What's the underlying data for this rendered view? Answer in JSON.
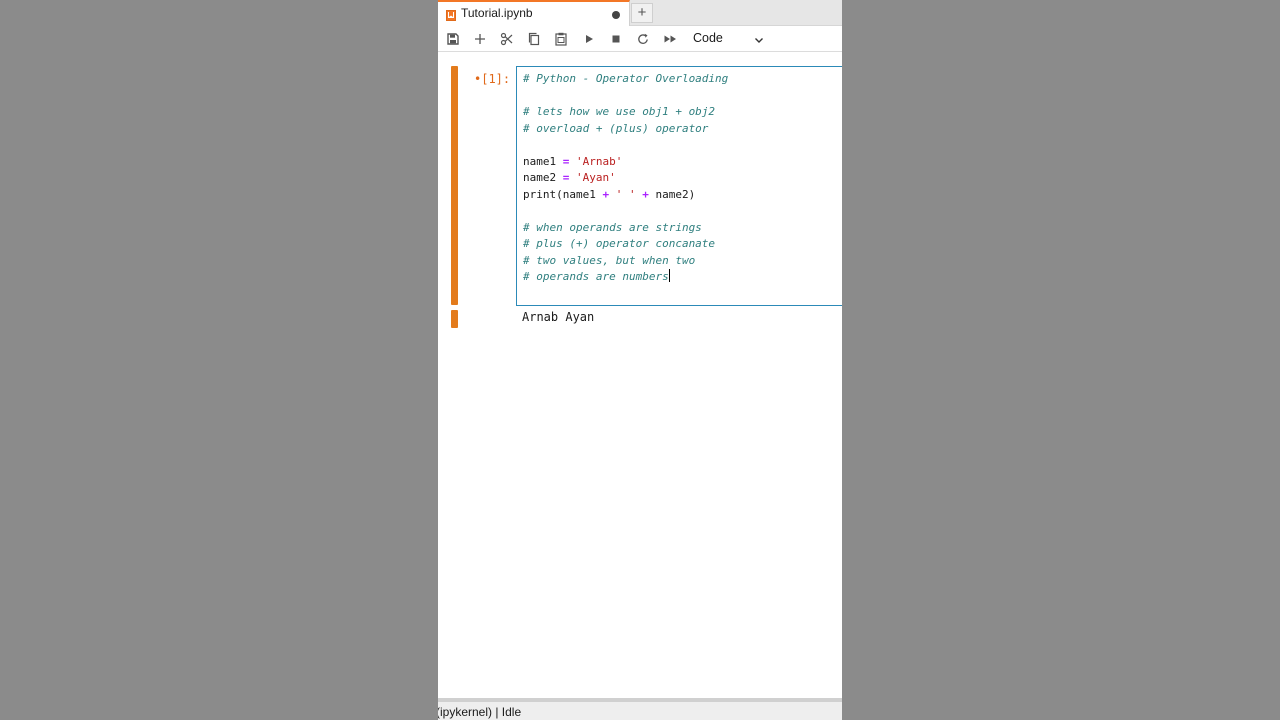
{
  "tab": {
    "title": "Tutorial.ipynb",
    "new_tab_symbol": "+"
  },
  "toolbar": {
    "buttons": [
      "save-icon",
      "plus-icon",
      "scissors-icon",
      "copy-icon",
      "paste-icon",
      "run-icon",
      "stop-icon",
      "restart-icon",
      "fast-forward-icon"
    ],
    "cell_type": "Code"
  },
  "cell": {
    "prompt": "•[1]:",
    "output": "Arnab Ayan"
  },
  "status": {
    "text": "(ipykernel) | Idle"
  },
  "colors": {
    "accent": "#e37b1c",
    "editor_border": "#2c8ab8",
    "comment": "#2f7f7f",
    "string": "#ba2121",
    "operator": "#aa22ff"
  },
  "code": {
    "l1": "# Python - Operator Overloading",
    "l3": "# lets how we use obj1 + obj2",
    "l4": "# overload + (plus) operator",
    "l6_a": "name1 ",
    "l6_op": "=",
    "l6_b": " ",
    "l6_str": "'Arnab'",
    "l7_a": "name2 ",
    "l7_op": "=",
    "l7_b": " ",
    "l7_str": "'Ayan'",
    "l8_a": "print(name1 ",
    "l8_op1": "+",
    "l8_b": " ",
    "l8_str": "' '",
    "l8_c": " ",
    "l8_op2": "+",
    "l8_d": " name2)",
    "l10": "# when operands are strings",
    "l11": "# plus (+) operator concanate",
    "l12": "# two values, but when two",
    "l13": "# operands are numbers"
  }
}
